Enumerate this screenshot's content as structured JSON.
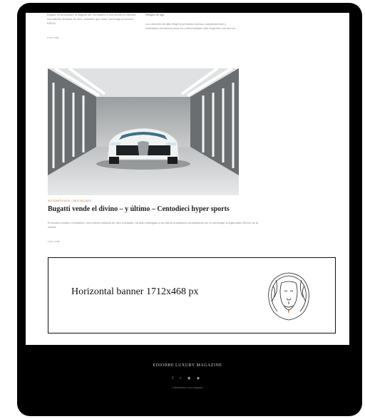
{
  "top_articles": {
    "col1_excerpt": "Bugatti ha anunciado la llegada del Centodieci a sus primeros clientes, una edición limitada de diez unidades que rinde homenaje al icónico EB110.",
    "col1_read_more": "Leer más",
    "col2_title": "Relojes de lujo",
    "col2_excerpt": "La colección de alta relojería presenta nuevas complicaciones y materiales exclusivos para los coleccionistas más exigentes del mundo.",
    "col2_read_more": "Leer más"
  },
  "featured": {
    "categories": "AUTOMÓVILES · DESTACADO",
    "headline": "Bugatti vende el divino – y último – Centodieci hyper sports",
    "excerpt": "El icónico modelo Centodieci, una edición limitada de diez unidades, ha sido entregado a su último propietario completando así el homenaje al legendario EB110 de la marca.",
    "read_more": "Leer más"
  },
  "banner": {
    "text": "Horizontal banner 1712x468 px"
  },
  "footer": {
    "brand": "EDIOBRE LUXURY MAGAZINE",
    "socials": [
      "f",
      "t",
      "◉",
      "▶"
    ],
    "copyright": "© 2024 Edición Luxury Magazine"
  },
  "colors": {
    "frame": "#000000",
    "accent": "#c8722a",
    "footer_bg": "#000000"
  }
}
